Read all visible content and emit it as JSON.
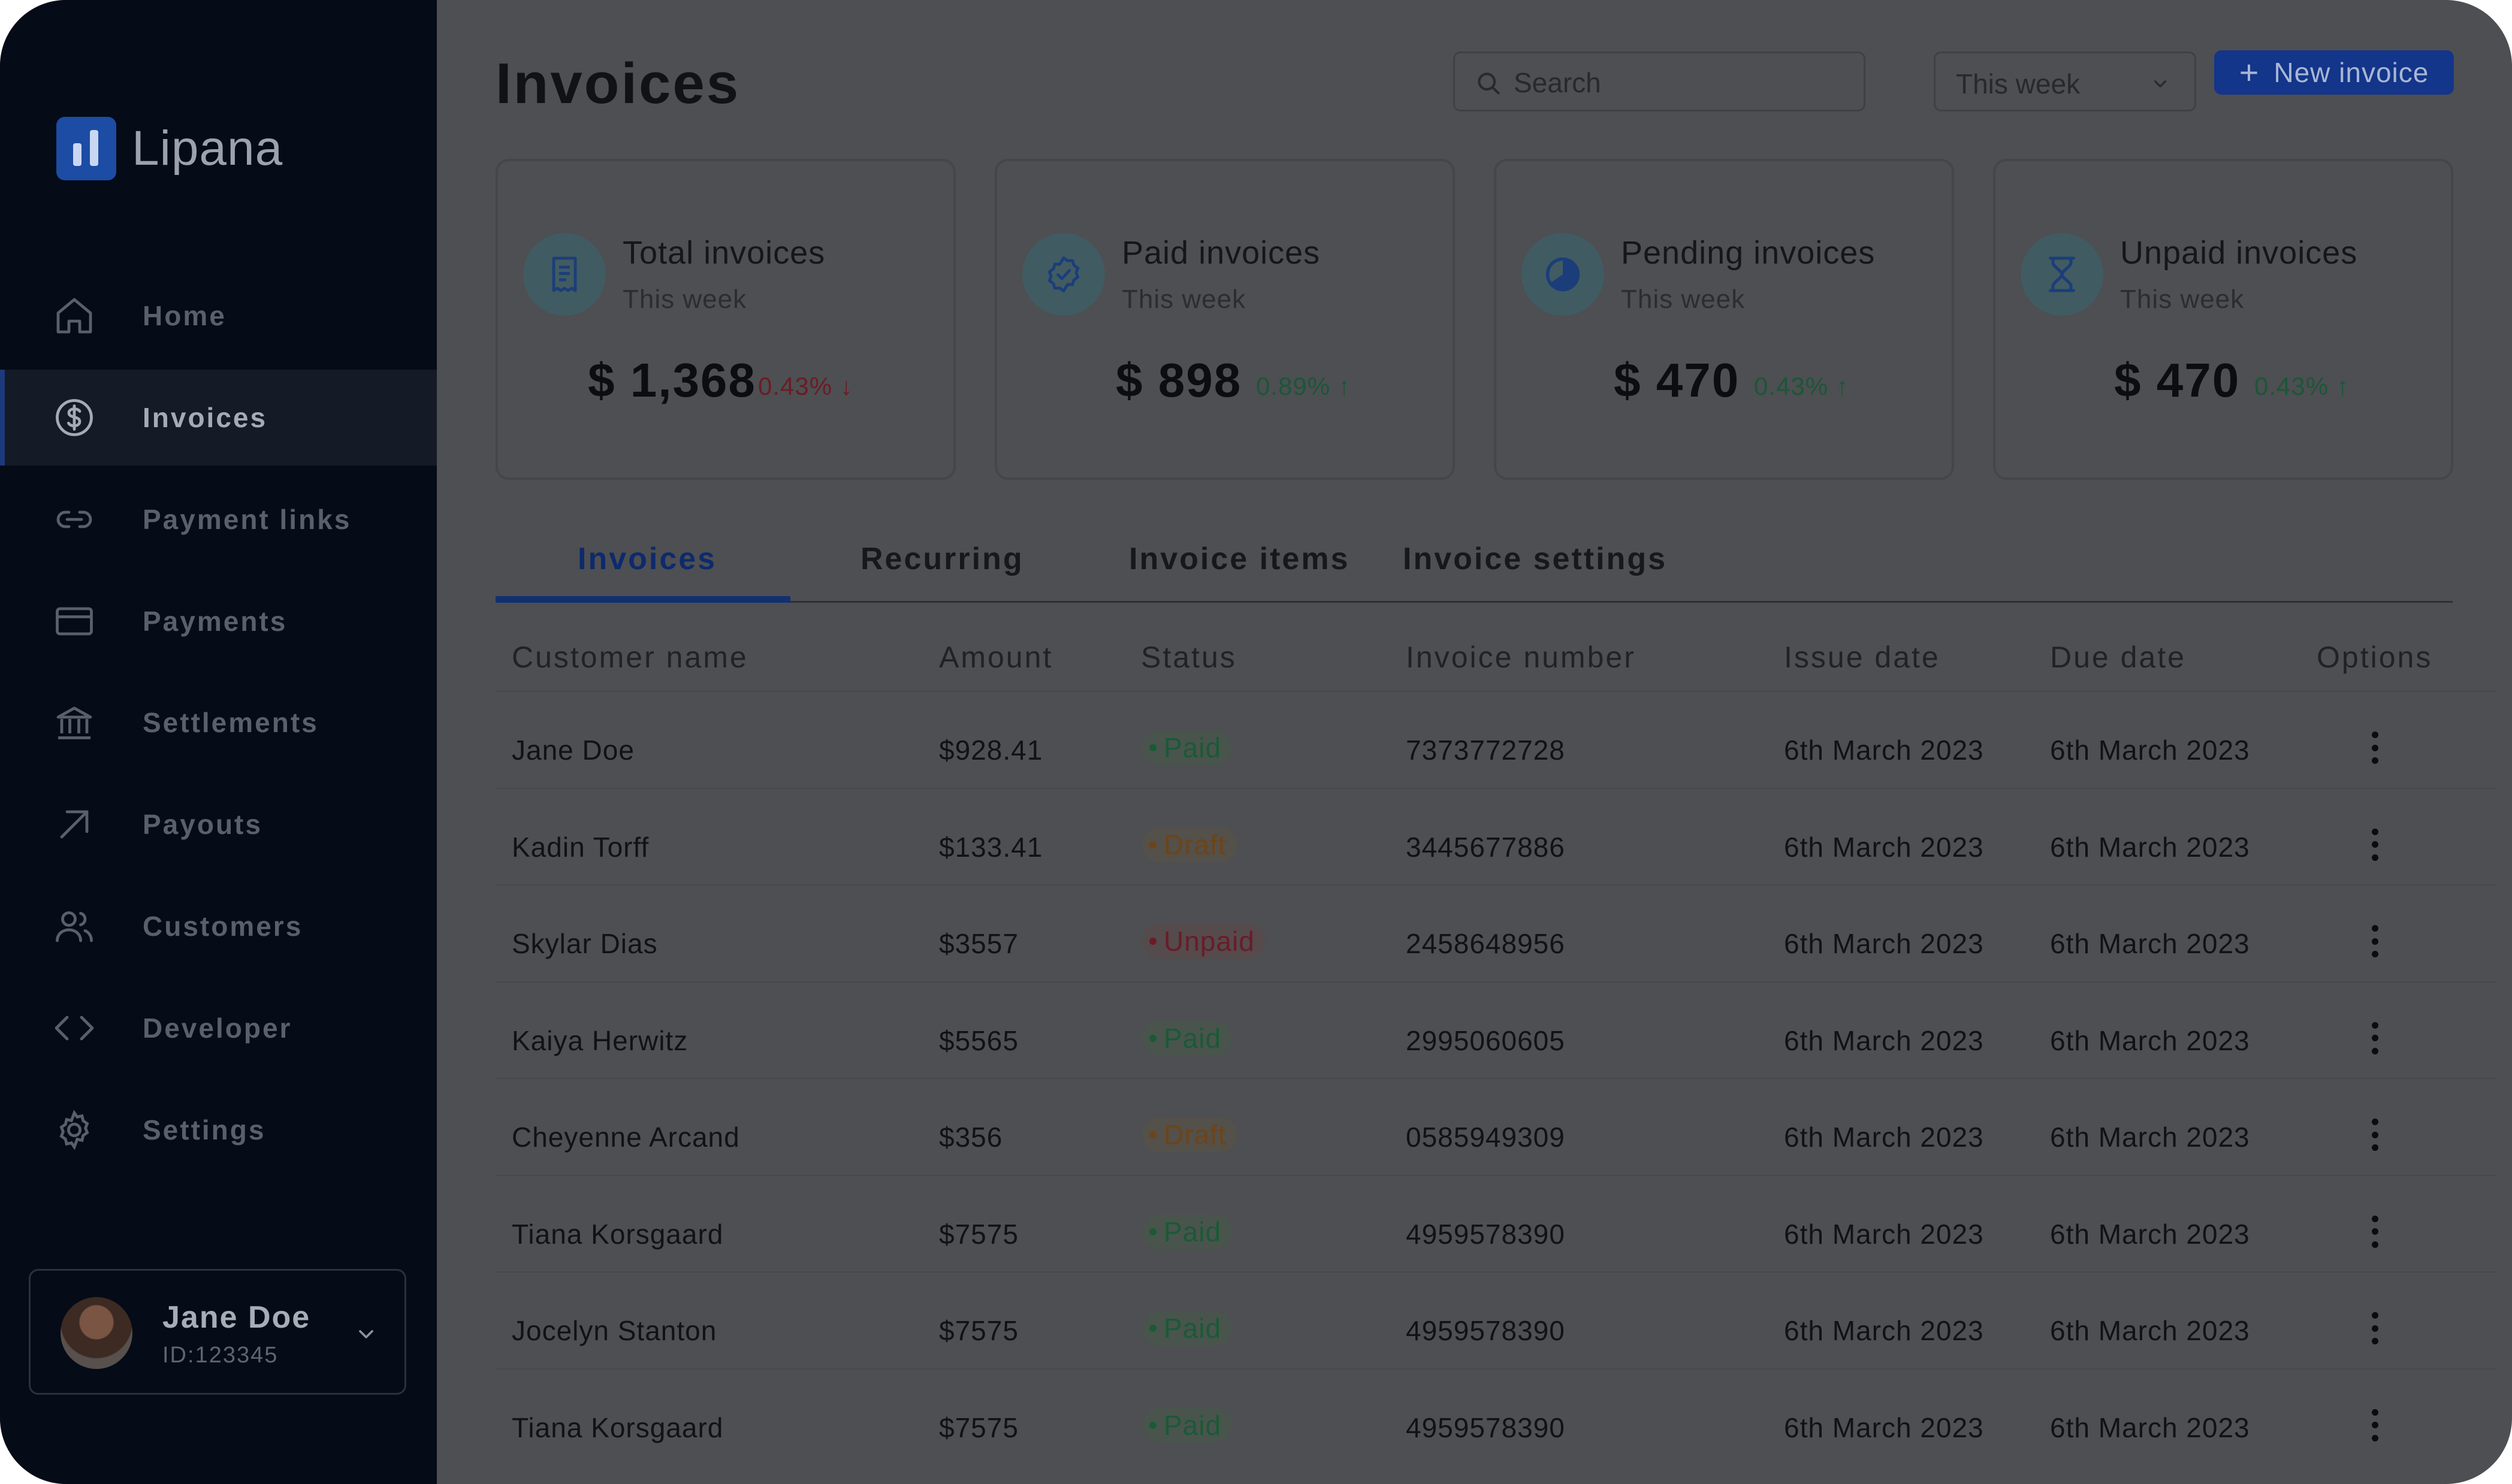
{
  "brand": {
    "name": "Lipana"
  },
  "sidebar": {
    "items": [
      {
        "label": "Home",
        "icon": "home-icon"
      },
      {
        "label": "Invoices",
        "icon": "dollar-circle-icon",
        "active": true
      },
      {
        "label": "Payment links",
        "icon": "link-icon"
      },
      {
        "label": "Payments",
        "icon": "credit-card-icon"
      },
      {
        "label": "Settlements",
        "icon": "bank-icon"
      },
      {
        "label": "Payouts",
        "icon": "arrow-up-right-icon"
      },
      {
        "label": "Customers",
        "icon": "users-icon"
      },
      {
        "label": "Developer",
        "icon": "code-icon"
      },
      {
        "label": "Settings",
        "icon": "gear-icon"
      }
    ],
    "user": {
      "name": "Jane Doe",
      "id": "ID:123345"
    }
  },
  "header": {
    "title": "Invoices",
    "search_placeholder": "Search",
    "period": "This week",
    "new_invoice_label": "New invoice"
  },
  "cards": [
    {
      "title": "Total invoices",
      "period": "This week",
      "value": "$ 1,368",
      "change": "0.43%",
      "direction": "down",
      "icon": "receipt-icon"
    },
    {
      "title": "Paid invoices",
      "period": "This week",
      "value": "$ 898",
      "change": "0.89%",
      "direction": "up",
      "icon": "verified-badge-icon"
    },
    {
      "title": "Pending invoices",
      "period": "This week",
      "value": "$ 470",
      "change": "0.43%",
      "direction": "up",
      "icon": "pie-chart-icon"
    },
    {
      "title": "Unpaid invoices",
      "period": "This week",
      "value": "$ 470",
      "change": "0.43%",
      "direction": "up",
      "icon": "hourglass-icon"
    }
  ],
  "tabs": [
    {
      "label": "Invoices",
      "active": true
    },
    {
      "label": "Recurring"
    },
    {
      "label": "Invoice items"
    },
    {
      "label": "Invoice settings"
    }
  ],
  "table": {
    "columns": [
      "Customer name",
      "Amount",
      "Status",
      "Invoice number",
      "Issue date",
      "Due date",
      "Options"
    ],
    "rows": [
      {
        "customer": "Jane Doe",
        "amount": "$928.41",
        "status": "Paid",
        "number": "7373772728",
        "issue": "6th March 2023",
        "due": "6th March 2023"
      },
      {
        "customer": "Kadin Torff",
        "amount": "$133.41",
        "status": "Draft",
        "number": "3445677886",
        "issue": "6th March 2023",
        "due": "6th March 2023"
      },
      {
        "customer": "Skylar Dias",
        "amount": "$3557",
        "status": "Unpaid",
        "number": "2458648956",
        "issue": "6th March 2023",
        "due": "6th March 2023"
      },
      {
        "customer": "Kaiya Herwitz",
        "amount": "$5565",
        "status": "Paid",
        "number": "2995060605",
        "issue": "6th March 2023",
        "due": "6th March 2023"
      },
      {
        "customer": "Cheyenne Arcand",
        "amount": "$356",
        "status": "Draft",
        "number": "0585949309",
        "issue": "6th March 2023",
        "due": "6th March 2023"
      },
      {
        "customer": "Tiana Korsgaard",
        "amount": "$7575",
        "status": "Paid",
        "number": "4959578390",
        "issue": "6th March 2023",
        "due": "6th March 2023"
      },
      {
        "customer": "Jocelyn Stanton",
        "amount": "$7575",
        "status": "Paid",
        "number": "4959578390",
        "issue": "6th March 2023",
        "due": "6th March 2023"
      },
      {
        "customer": "Tiana Korsgaard",
        "amount": "$7575",
        "status": "Paid",
        "number": "4959578390",
        "issue": "6th March 2023",
        "due": "6th March 2023"
      }
    ]
  }
}
